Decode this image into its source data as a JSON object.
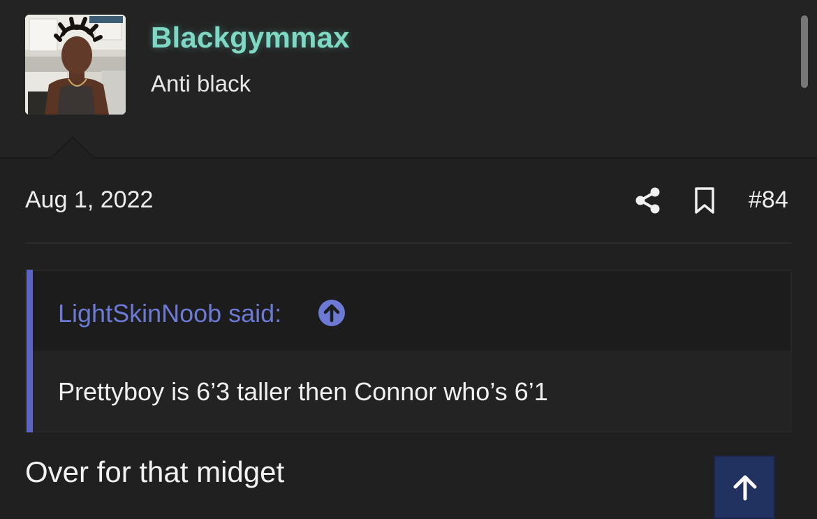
{
  "user": {
    "name": "Blackgymmax",
    "title": "Anti black"
  },
  "post": {
    "date": "Aug 1, 2022",
    "number": "#84",
    "share_icon": "share-icon",
    "bookmark_icon": "bookmark-icon"
  },
  "quote": {
    "author": "LightSkinNoob said:",
    "text": "Prettyboy is 6’3 taller then Connor who’s 6’1",
    "jump_icon": "arrow-up-circle-icon"
  },
  "message": {
    "text": "Over for that midget"
  },
  "back_to_top": {
    "icon": "arrow-up-icon"
  },
  "colors": {
    "username": "#7fd8c3",
    "quote_accent": "#5b64c2",
    "quote_author": "#6d7ad4",
    "back_to_top_bg": "#223260"
  }
}
